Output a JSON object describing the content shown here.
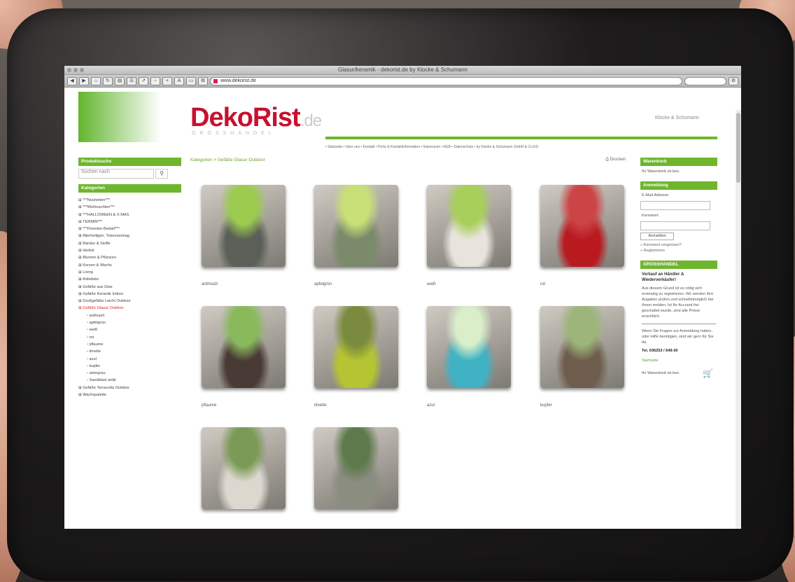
{
  "browser": {
    "title": "Glasur/keramik - dekorist.de by Klocke & Schumann",
    "url": "www.dekorist.de"
  },
  "logo": {
    "name": "DekoRist",
    "tld": ".de",
    "sub": "GROSSHANDEL",
    "partner": "Klocke & Schumann"
  },
  "topnav": "• Startseite • Über uns • Kontakt • Porto & Kontaktinformation • Impressum • AGB • Datenschutz • by Klocke & Schumann GmbH & Co.KG",
  "sidebar": {
    "search_title": "Produktsuche",
    "search_placeholder": "Suchen nach",
    "cat_title": "Kategorien",
    "items": [
      {
        "label": "***Neuheiten***",
        "sub": false
      },
      {
        "label": "***Weihnachten***",
        "sub": false
      },
      {
        "label": "***HALLOWEEN & X-MAS",
        "sub": false
      },
      {
        "label": "TERMIN***",
        "sub": false
      },
      {
        "label": "***Floristen-Bedarf***",
        "sub": false
      },
      {
        "label": "Allerheiligen, Totensonntag",
        "sub": false
      },
      {
        "label": "Bänder & Stoffe",
        "sub": false
      },
      {
        "label": "Herbst",
        "sub": false
      },
      {
        "label": "Blumen & Pflanzen",
        "sub": false
      },
      {
        "label": "Kerzen & Wachs",
        "sub": false
      },
      {
        "label": "Living",
        "sub": false
      },
      {
        "label": "Artikdeko",
        "sub": false
      },
      {
        "label": "Gefäße aus Glas",
        "sub": false
      },
      {
        "label": "Gefäße Keramik Indoor",
        "sub": false
      },
      {
        "label": "Großgefäße Leicht Outdoor",
        "sub": false
      },
      {
        "label": "Gefäße Glasur Outdoor",
        "sub": false,
        "active": true
      },
      {
        "label": "anthrazit",
        "sub": true
      },
      {
        "label": "apfelgrün",
        "sub": true
      },
      {
        "label": "weiß",
        "sub": true
      },
      {
        "label": "rot",
        "sub": true
      },
      {
        "label": "pflaume",
        "sub": true
      },
      {
        "label": "limette",
        "sub": true
      },
      {
        "label": "azul",
        "sub": true
      },
      {
        "label": "kupfer",
        "sub": true
      },
      {
        "label": "steingrau",
        "sub": true
      },
      {
        "label": "Sandblast antik",
        "sub": true
      },
      {
        "label": "Gefäße Terracotta Outdoor",
        "sub": false
      },
      {
        "label": "Wachspalette",
        "sub": false
      }
    ]
  },
  "main": {
    "breadcrumb": "Kategorien > Gefäße Glasur Outdoor",
    "print": "Drucken",
    "tiles": [
      {
        "label": "anthrazit",
        "color": "#5a5f57",
        "accent": "#9ccb4f"
      },
      {
        "label": "apfelgrün",
        "color": "#7a8a6a",
        "accent": "#c9e078"
      },
      {
        "label": "weiß",
        "color": "#e8e4dc",
        "accent": "#a8cf5a"
      },
      {
        "label": "rot",
        "color": "#b81a20",
        "accent": "#c44"
      },
      {
        "label": "pflaume",
        "color": "#4a3a36",
        "accent": "#8ab95c"
      },
      {
        "label": "limette",
        "color": "#b5c432",
        "accent": "#7a8a3e"
      },
      {
        "label": "azul",
        "color": "#3fb2c4",
        "accent": "#d9eec9"
      },
      {
        "label": "kupfer",
        "color": "#6e5d4c",
        "accent": "#9db57a"
      },
      {
        "label": "",
        "color": "#ddd8cf",
        "accent": "#7a9a55"
      },
      {
        "label": "",
        "color": "#8a8d80",
        "accent": "#5e7a4c"
      }
    ]
  },
  "right": {
    "cart_title": "Warenkorb",
    "cart_text": "Ihr Warenkorb ist leer.",
    "login_title": "Anmeldung",
    "email_label": "E-Mail-Adresse",
    "pass_label": "Kennwort",
    "login_btn": "Anmelden",
    "forgot": "» Kennwort vergessen?",
    "register": "» Registrieren",
    "wholesale_title": "GROSSHANDEL",
    "wholesale_head": "Verkauf an Händler & Wiederverkäufer!",
    "wholesale_text": "Aus diesem Grund ist es nötig sich erstmalig zu registrieren. Wir werden Ihre Angaben prüfen und schnellstmöglich bei Ihnen melden. Ist Ihr Account frei geschaltet wurde, sind alle Preise ersichtlich.",
    "contact_text": "Wenn Sie Fragen zur Anmeldung haben, oder Hilfe benötigen, sind wir gern für Sie da.",
    "phone": "Tel. 036253 / 549-30",
    "bottom_link": "Startseite",
    "bottom_cart": "Ihr Warenkorb ist leer."
  }
}
